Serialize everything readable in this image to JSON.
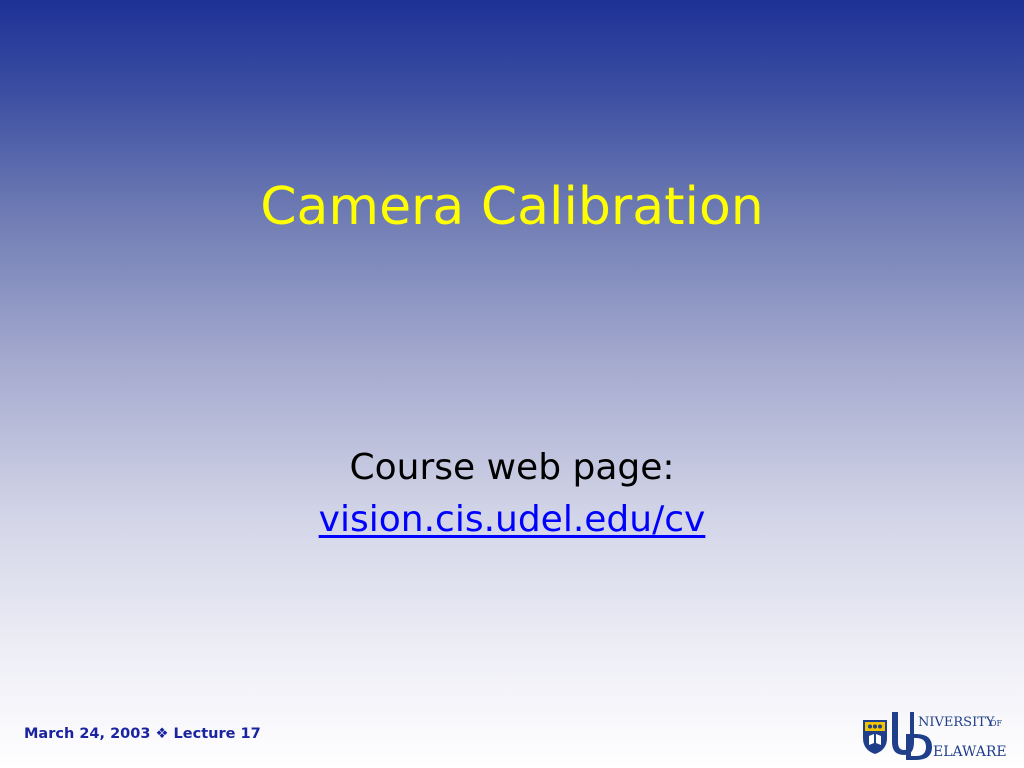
{
  "slide": {
    "title": "Camera Calibration",
    "body_line": "Course web page:",
    "link_text": "vision.cis.udel.edu/cv",
    "footer": {
      "date": "March 24, 2003",
      "separator": "❖",
      "lecture": "Lecture 17"
    },
    "logo_text": "UNIVERSITY OF DELAWARE"
  },
  "colors": {
    "title": "#ffff00",
    "link": "#0000ff",
    "footer": "#1a24a0",
    "bg_top": "#1d3196",
    "bg_bottom": "#ffffff"
  }
}
